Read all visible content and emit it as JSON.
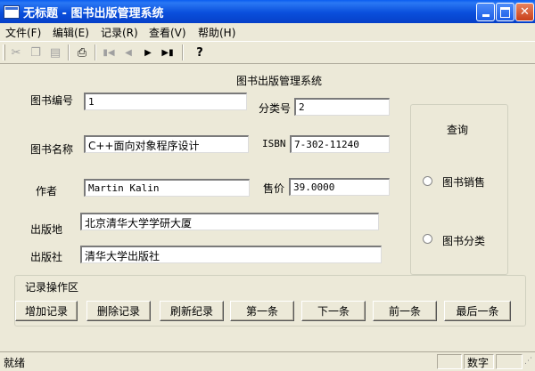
{
  "window": {
    "title": "无标题 - 图书出版管理系统",
    "minimize_icon": "minimize-icon",
    "maximize_icon": "maximize-icon",
    "close_icon": "close-icon"
  },
  "menu": [
    "文件(F)",
    "编辑(E)",
    "记录(R)",
    "查看(V)",
    "帮助(H)"
  ],
  "toolbar": {
    "icons": [
      "cut-icon",
      "copy-icon",
      "paste-icon",
      "print-icon",
      "first-record-icon",
      "prev-record-icon",
      "next-record-icon",
      "last-record-icon",
      "help-icon"
    ]
  },
  "form": {
    "heading": "图书出版管理系统",
    "book_id_label": "图书编号",
    "book_id_value": "1",
    "category_label": "分类号",
    "category_value": "2",
    "book_name_label": "图书名称",
    "book_name_value": "C++面向对象程序设计",
    "isbn_label": "ISBN",
    "isbn_value": "7-302-11240",
    "author_label": "作者",
    "author_value": "Martin Kalin",
    "price_label": "售价",
    "price_value": "39.0000",
    "place_label": "出版地",
    "place_value": "北京清华大学学研大厦",
    "publisher_label": "出版社",
    "publisher_value": "清华大学出版社"
  },
  "query": {
    "title": "查询",
    "option_sales": "图书销售",
    "option_category": "图书分类"
  },
  "records": {
    "title": "记录操作区",
    "add": "增加记录",
    "delete": "删除记录",
    "refresh": "刷新纪录",
    "first": "第一条",
    "next": "下一条",
    "prev": "前一条",
    "last": "最后一条"
  },
  "status": {
    "text": "就绪",
    "num": "数字"
  }
}
